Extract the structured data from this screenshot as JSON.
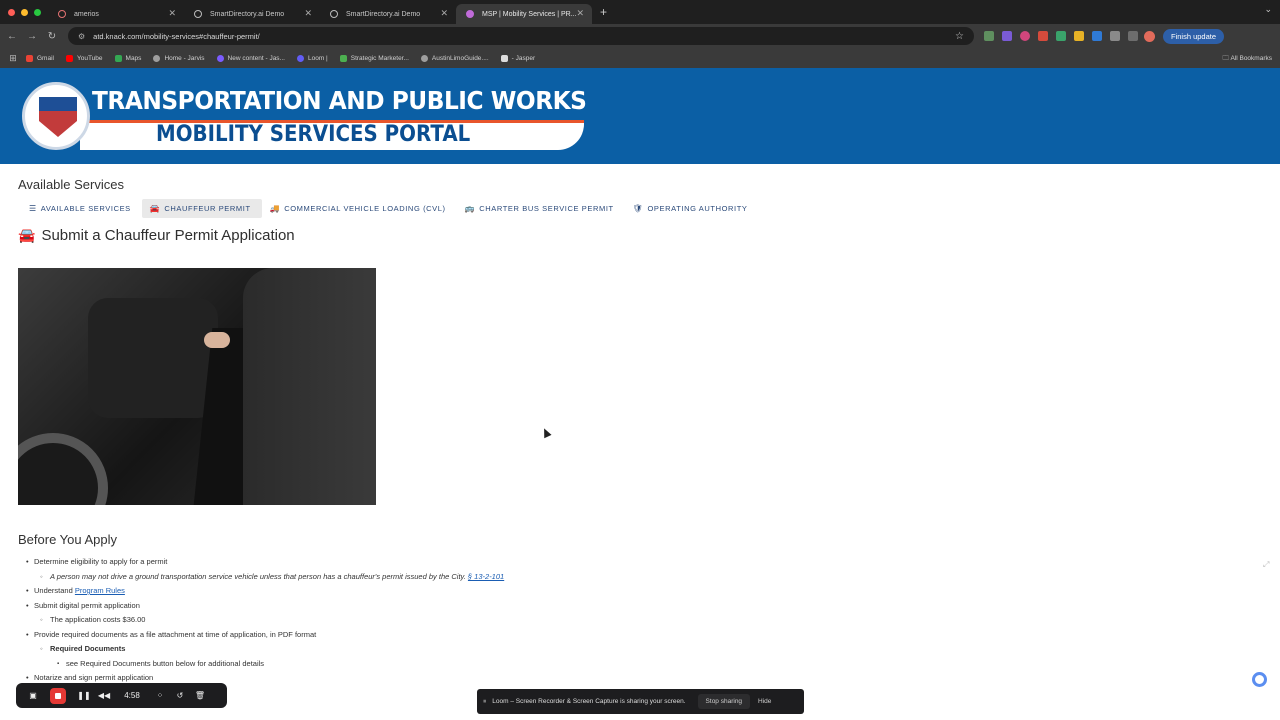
{
  "browser": {
    "tabs": [
      {
        "label": "amerios"
      },
      {
        "label": "SmartDirectory.ai Demo"
      },
      {
        "label": "SmartDirectory.ai Demo"
      },
      {
        "label": "MSP | Mobility Services | PR..."
      }
    ],
    "url": "atd.knack.com/mobility-services#chauffeur-permit/",
    "finish_update": "Finish update",
    "bookmarks": [
      "Gmail",
      "YouTube",
      "Maps",
      "Home - Jarvis",
      "New content - Jas...",
      "Loom |",
      "Strategic Marketer...",
      "AustinLimoGuide....",
      "- Jasper"
    ],
    "all_bookmarks": "All Bookmarks"
  },
  "banner": {
    "title": "TRANSPORTATION AND PUBLIC WORKS",
    "subtitle": "MOBILITY SERVICES PORTAL",
    "seal_text": "CITY OF AUSTIN"
  },
  "page": {
    "section_title": "Available Services",
    "subnav": [
      {
        "icon": "☰",
        "label": "AVAILABLE SERVICES"
      },
      {
        "icon": "🚘",
        "label": "CHAUFFEUR PERMIT"
      },
      {
        "icon": "🚚",
        "label": "COMMERCIAL VEHICLE LOADING (CVL)"
      },
      {
        "icon": "🚌",
        "label": "CHARTER BUS SERVICE PERMIT"
      },
      {
        "icon": "🛡",
        "label": "OPERATING AUTHORITY"
      }
    ],
    "heading": "Submit a Chauffeur Permit Application",
    "before_title": "Before You Apply",
    "list": {
      "item1": "Determine eligibility to apply for a permit",
      "item1_sub": "A person may not drive a ground transportation service vehicle unless that person has a chauffeur's permit issued by the City.",
      "item1_link": "§ 13-2-101",
      "item2_prefix": "Understand",
      "item2_link": "Program Rules",
      "item3": "Submit digital permit application",
      "item3_sub": "The application costs $36.00",
      "item4": "Provide required documents as a file attachment at time of application, in PDF format",
      "item4_sub": "Required Documents",
      "item4_sub2": "see Required Documents button below for additional details",
      "item5": "Notarize and sign permit application"
    }
  },
  "recorder": {
    "time": "4:58"
  },
  "share_bar": {
    "message": "Loom – Screen Recorder & Screen Capture is sharing your screen.",
    "stop": "Stop sharing",
    "hide": "Hide"
  }
}
